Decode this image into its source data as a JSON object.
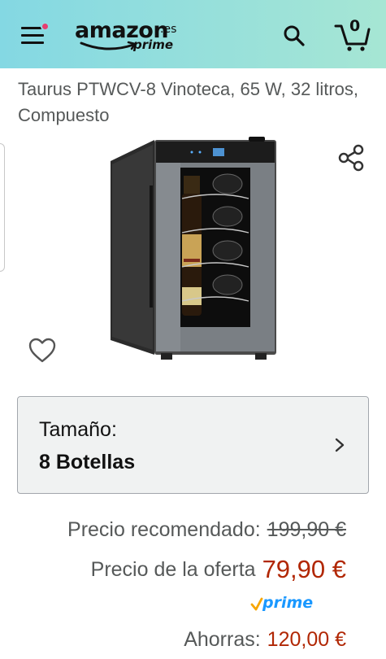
{
  "header": {
    "logo_word": "amazon",
    "logo_tld": ".es",
    "logo_sub": "prime",
    "cart_count": "0",
    "icons": {
      "menu": "hamburger-icon",
      "search": "search-icon",
      "cart": "cart-icon"
    },
    "colors": {
      "bar_start": "#84d8e3",
      "bar_end": "#a6e6d4",
      "notification_dot": "#e63d6f"
    }
  },
  "product": {
    "title": "Taurus PTWCV-8 Vinoteca, 65 W, 32 litros, Compuesto",
    "image_icon": "wine-cooler-image",
    "share_icon": "share-icon",
    "wishlist_icon": "heart-icon"
  },
  "size_selector": {
    "label": "Tamaño:",
    "value": "8 Botellas",
    "icon": "chevron-right-icon"
  },
  "pricing": {
    "list_label": "Precio recomendado:",
    "list_price": "199,90 €",
    "deal_label": "Precio de la oferta",
    "deal_price": "79,90 €",
    "prime_label": "prime",
    "savings_label": "Ahorras:",
    "savings_value": "120,00 €",
    "colors": {
      "deal": "#b12704",
      "label": "#565959",
      "prime": "#1a98ff",
      "prime_check": "#f7a600"
    }
  }
}
